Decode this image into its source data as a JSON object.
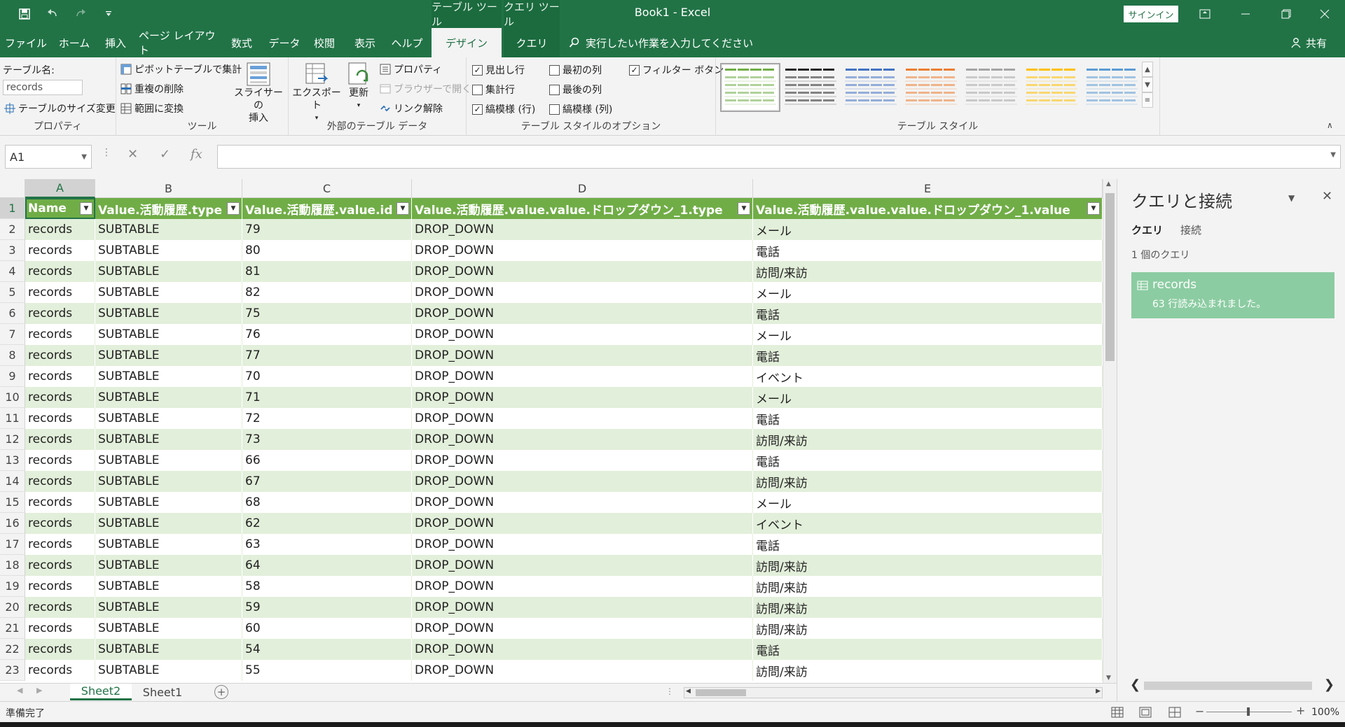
{
  "app": {
    "title": "Book1  -  Excel",
    "context_groups": [
      "テーブル ツール",
      "クエリ ツール"
    ],
    "signin": "サインイン"
  },
  "tabs": {
    "items": [
      "ファイル",
      "ホーム",
      "挿入",
      "ページ レイアウト",
      "数式",
      "データ",
      "校閲",
      "表示",
      "ヘルプ",
      "デザイン",
      "クエリ"
    ],
    "active": "デザイン",
    "tell_me": "実行したい作業を入力してください",
    "share": "共有"
  },
  "ribbon": {
    "properties": {
      "table_name_label": "テーブル名:",
      "table_name_value": "records",
      "resize": "テーブルのサイズ変更",
      "group": "プロパティ"
    },
    "tools": {
      "pivot": "ピボットテーブルで集計",
      "dedupe": "重複の削除",
      "convert": "範囲に変換",
      "slicer_line1": "スライサーの",
      "slicer_line2": "挿入",
      "group": "ツール"
    },
    "external": {
      "export": "エクスポート",
      "refresh": "更新",
      "properties": "プロパティ",
      "open_browser": "ブラウザーで開く",
      "unlink": "リンク解除",
      "group": "外部のテーブル データ"
    },
    "style_options": {
      "header_row": "見出し行",
      "total_row": "集計行",
      "banded_rows": "縞模様 (行)",
      "first_column": "最初の列",
      "last_column": "最後の列",
      "banded_columns": "縞模様 (列)",
      "filter_button": "フィルター ボタン",
      "group": "テーブル スタイルのオプション"
    },
    "styles": {
      "group": "テーブル スタイル",
      "colors": [
        "#70ad47",
        "#262626",
        "#4472c4",
        "#ed7d31",
        "#a5a5a5",
        "#ffc000",
        "#5b9bd5"
      ]
    }
  },
  "formula_bar": {
    "name_box": "A1",
    "fx": "fx",
    "content": ""
  },
  "sheet": {
    "columns": [
      "A",
      "B",
      "C",
      "D",
      "E"
    ],
    "header": [
      "Name",
      "Value.活動履歴.type",
      "Value.活動履歴.value.id",
      "Value.活動履歴.value.value.ドロップダウン_1.type",
      "Value.活動履歴.value.value.ドロップダウン_1.value"
    ],
    "rows": [
      {
        "n": "2",
        "a": "records",
        "b": "SUBTABLE",
        "c": "79",
        "d": "DROP_DOWN",
        "e": "メール"
      },
      {
        "n": "3",
        "a": "records",
        "b": "SUBTABLE",
        "c": "80",
        "d": "DROP_DOWN",
        "e": "電話"
      },
      {
        "n": "4",
        "a": "records",
        "b": "SUBTABLE",
        "c": "81",
        "d": "DROP_DOWN",
        "e": "訪問/来訪"
      },
      {
        "n": "5",
        "a": "records",
        "b": "SUBTABLE",
        "c": "82",
        "d": "DROP_DOWN",
        "e": "メール"
      },
      {
        "n": "6",
        "a": "records",
        "b": "SUBTABLE",
        "c": "75",
        "d": "DROP_DOWN",
        "e": "電話"
      },
      {
        "n": "7",
        "a": "records",
        "b": "SUBTABLE",
        "c": "76",
        "d": "DROP_DOWN",
        "e": "メール"
      },
      {
        "n": "8",
        "a": "records",
        "b": "SUBTABLE",
        "c": "77",
        "d": "DROP_DOWN",
        "e": "電話"
      },
      {
        "n": "9",
        "a": "records",
        "b": "SUBTABLE",
        "c": "70",
        "d": "DROP_DOWN",
        "e": "イベント"
      },
      {
        "n": "10",
        "a": "records",
        "b": "SUBTABLE",
        "c": "71",
        "d": "DROP_DOWN",
        "e": "メール"
      },
      {
        "n": "11",
        "a": "records",
        "b": "SUBTABLE",
        "c": "72",
        "d": "DROP_DOWN",
        "e": "電話"
      },
      {
        "n": "12",
        "a": "records",
        "b": "SUBTABLE",
        "c": "73",
        "d": "DROP_DOWN",
        "e": "訪問/来訪"
      },
      {
        "n": "13",
        "a": "records",
        "b": "SUBTABLE",
        "c": "66",
        "d": "DROP_DOWN",
        "e": "電話"
      },
      {
        "n": "14",
        "a": "records",
        "b": "SUBTABLE",
        "c": "67",
        "d": "DROP_DOWN",
        "e": "訪問/来訪"
      },
      {
        "n": "15",
        "a": "records",
        "b": "SUBTABLE",
        "c": "68",
        "d": "DROP_DOWN",
        "e": "メール"
      },
      {
        "n": "16",
        "a": "records",
        "b": "SUBTABLE",
        "c": "62",
        "d": "DROP_DOWN",
        "e": "イベント"
      },
      {
        "n": "17",
        "a": "records",
        "b": "SUBTABLE",
        "c": "63",
        "d": "DROP_DOWN",
        "e": "電話"
      },
      {
        "n": "18",
        "a": "records",
        "b": "SUBTABLE",
        "c": "64",
        "d": "DROP_DOWN",
        "e": "訪問/来訪"
      },
      {
        "n": "19",
        "a": "records",
        "b": "SUBTABLE",
        "c": "58",
        "d": "DROP_DOWN",
        "e": "訪問/来訪"
      },
      {
        "n": "20",
        "a": "records",
        "b": "SUBTABLE",
        "c": "59",
        "d": "DROP_DOWN",
        "e": "訪問/来訪"
      },
      {
        "n": "21",
        "a": "records",
        "b": "SUBTABLE",
        "c": "60",
        "d": "DROP_DOWN",
        "e": "訪問/来訪"
      },
      {
        "n": "22",
        "a": "records",
        "b": "SUBTABLE",
        "c": "54",
        "d": "DROP_DOWN",
        "e": "電話"
      },
      {
        "n": "23",
        "a": "records",
        "b": "SUBTABLE",
        "c": "55",
        "d": "DROP_DOWN",
        "e": "訪問/来訪"
      }
    ],
    "tabs": [
      "Sheet2",
      "Sheet1"
    ],
    "active_tab": "Sheet2"
  },
  "query_pane": {
    "title": "クエリと接続",
    "tab_queries": "クエリ",
    "tab_connections": "接続",
    "count": "1 個のクエリ",
    "query_name": "records",
    "query_status": "63 行読み込まれました。"
  },
  "status": {
    "ready": "準備完了",
    "zoom": "100%"
  },
  "colors": {
    "excel_green": "#217346",
    "table_header": "#70ad47",
    "table_band": "#e2efda",
    "query_card": "#8ccca2"
  }
}
